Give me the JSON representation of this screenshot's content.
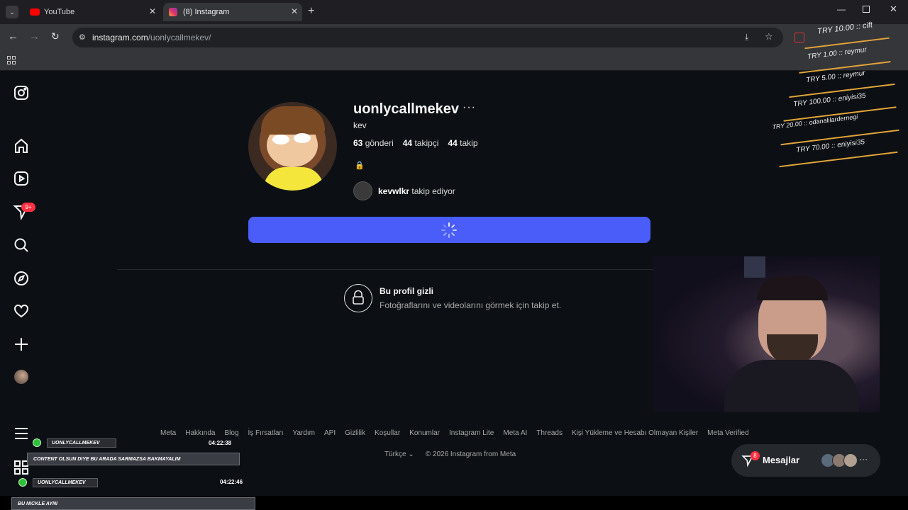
{
  "browser": {
    "tabs": [
      {
        "title": "YouTube",
        "icon": "youtube-icon"
      },
      {
        "title": "(8) Instagram",
        "icon": "instagram-icon"
      }
    ],
    "url_host": "instagram.com",
    "url_path": "/uonlycallmekev/"
  },
  "sidebar": {
    "notification_badge": "9+"
  },
  "profile": {
    "username": "uonlycallmekev",
    "more_glyph": "···",
    "full_name": "kev",
    "posts_count": "63",
    "posts_label": "gönderi",
    "followers_count": "44",
    "followers_label": "takipçi",
    "following_count": "44",
    "following_label": "takip",
    "bio_emoji": "🔒",
    "mutual_user": "kevwlkr",
    "mutual_text": "takip ediyor"
  },
  "private": {
    "title": "Bu profil gizli",
    "subtitle": "Fotoğraflarını ve videolarını görmek için takip et."
  },
  "footer": {
    "links": [
      "Meta",
      "Hakkında",
      "Blog",
      "İş Fırsatları",
      "Yardım",
      "API",
      "Gizlilik",
      "Koşullar",
      "Konumlar",
      "Instagram Lite",
      "Meta AI",
      "Threads",
      "Kişi Yükleme ve Hesabı Olmayan Kişiler",
      "Meta Verified"
    ],
    "language": "Türkçe",
    "copyright": "© 2026 Instagram from Meta"
  },
  "messages": {
    "label": "Mesajlar",
    "badge": "8"
  },
  "donations": [
    "TRY 10.00 :: cift",
    "TRY 1.00 :: reymur",
    "TRY 5.00 :: reymur",
    "TRY 100.00 :: eniyisi35",
    "TRY 20.00 :: odanalilardernegi",
    "TRY 70.00 :: eniyisi35"
  ],
  "chat": [
    {
      "user": "UONLYCALLMEKEV",
      "time": "04:22:38",
      "message": "CONTENT OLSUN DIYE BU ARADA SARMAZSA BAKMAYALIM"
    },
    {
      "user": "UONLYCALLMEKEV",
      "time": "04:22:46",
      "message": "BU NICKLE AYNI"
    }
  ],
  "colors": {
    "background": "#0c1014",
    "follow_button": "#4a5df9",
    "badge": "#ff3040",
    "overlay_accent": "#e1a33a"
  }
}
